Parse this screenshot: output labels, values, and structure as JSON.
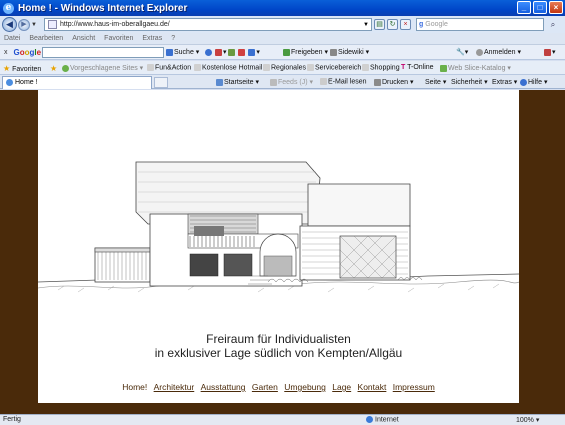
{
  "window": {
    "title": "Home ! - Windows Internet Explorer",
    "controls": [
      "_",
      "□",
      "×"
    ]
  },
  "address_bar": {
    "url": "http://www.haus-im-oberallgaeu.de/",
    "search_placeholder": "Google"
  },
  "menu": {
    "items": [
      "Datei",
      "Bearbeiten",
      "Ansicht",
      "Favoriten",
      "Extras",
      "?"
    ]
  },
  "google_toolbar": {
    "close": "x",
    "logo": [
      "G",
      "o",
      "o",
      "g",
      "l",
      "e"
    ],
    "search_label": "Suche",
    "share_label": "Freigeben",
    "sidewiki_label": "Sidewiki",
    "signin_label": "Anmelden"
  },
  "favorites_bar": {
    "favorites_label": "Favoriten",
    "items": [
      "Vorgeschlagene Sites",
      "Fun&Action",
      "Kostenlose Hotmail",
      "Regionales",
      "Servicebereich",
      "Shopping",
      "T-Online",
      "Web Slice-Katalog"
    ]
  },
  "tab": {
    "title": "Home !"
  },
  "command_bar": {
    "items": [
      "Startseite",
      "Feeds (J)",
      "E-Mail lesen",
      "Drucken",
      "Seite",
      "Sicherheit",
      "Extras",
      "Hilfe"
    ]
  },
  "page": {
    "tagline_1": "Freiraum für Individualisten",
    "tagline_2": "in exklusiver Lage südlich von Kempten/Allgäu",
    "nav": [
      "Home!",
      "Architektur",
      "Ausstattung",
      "Garten",
      "Umgebung",
      "Lage",
      "Kontakt",
      "Impressum"
    ]
  },
  "status_bar": {
    "status": "Fertig",
    "zone": "Internet",
    "zoom": "100%"
  },
  "colors": {
    "page_background": "#4a2a0a",
    "link_color": "#4a2a0a",
    "titlebar": "#0046c8"
  }
}
